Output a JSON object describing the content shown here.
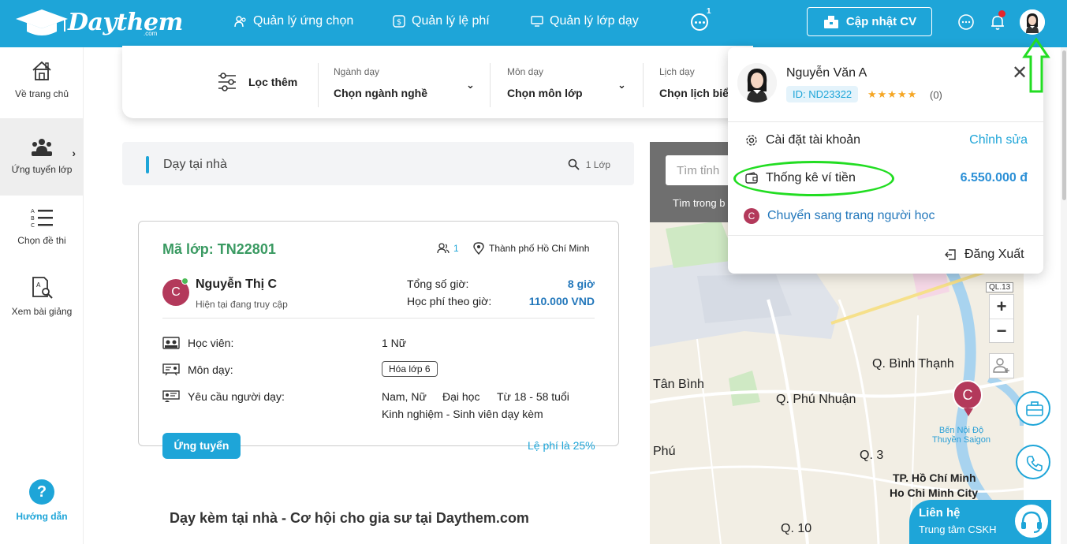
{
  "header": {
    "brand": "Daythem",
    "brand_suffix": ".com",
    "nav": [
      {
        "label": "Quản lý ứng chọn",
        "icon": "users-icon"
      },
      {
        "label": "Quản lý lệ phí",
        "icon": "dollar-icon"
      },
      {
        "label": "Quản lý lớp dạy",
        "icon": "monitor-icon"
      }
    ],
    "more_badge": "1",
    "cv_button": "Cập nhật CV"
  },
  "sidebar": {
    "items": [
      {
        "label": "Về trang chủ",
        "icon": "home-icon"
      },
      {
        "label": "Ứng tuyển lớp",
        "icon": "group-icon",
        "active": true
      },
      {
        "label": "Chọn đề thi",
        "icon": "abc-list-icon"
      },
      {
        "label": "Xem bài giảng",
        "icon": "document-search-icon"
      }
    ],
    "help_label": "Hướng dẫn",
    "help_symbol": "?"
  },
  "filter": {
    "main_label": "Lọc thêm",
    "groups": [
      {
        "label": "Ngành dạy",
        "value": "Chọn ngành nghề"
      },
      {
        "label": "Môn dạy",
        "value": "Chọn môn lớp"
      },
      {
        "label": "Lịch dạy",
        "value": "Chọn lịch biểu"
      }
    ]
  },
  "section": {
    "title": "Dạy tại nhà",
    "count": "1 Lớp"
  },
  "card": {
    "code": "Mã lớp: TN22801",
    "people": "1",
    "location": "Thành phố Hồ Chí Minh",
    "avatar_letter": "C",
    "name": "Nguyễn Thị C",
    "status": "Hiện tại đang truy cập",
    "hours_label": "Tổng số giờ:",
    "hours_value": "8 giờ",
    "fee_label": "Học phí theo giờ:",
    "fee_value": "110.000 VND",
    "students_label": "Học viên:",
    "students_value": "1 Nữ",
    "subject_label": "Môn dạy:",
    "subject_value": "Hóa lớp 6",
    "req_label": "Yêu cầu người dạy:",
    "req_gender": "Nam, Nữ",
    "req_level": "Đại học",
    "req_age": "Từ 18 - 58 tuổi",
    "req_exp": "Kinh nghiệm - Sinh viên dạy kèm",
    "apply_button": "Ứng tuyển",
    "fee_note": "Lệ phí là 25%"
  },
  "footer_text": "Dạy kèm tại nhà - Cơ hội cho gia sư tại Daythem.com",
  "map": {
    "search_placeholder": "Tìm tỉnh",
    "hint": "Tìm trong b",
    "labels": {
      "binh_thanh": "Q. Bình Thạnh",
      "tan_binh": "Tân Bình",
      "phu_nhuan": "Q. Phú Nhuận",
      "phu": "Phú",
      "q3": "Q. 3",
      "q10": "Q. 10",
      "city_vi": "TP. Hồ Chí Minh",
      "city_en": "Ho Chi Minh City",
      "ql": "QL.13",
      "ferry_1": "Bến Nội Độ",
      "ferry_2": "Thuyền Saigon"
    },
    "pin_letter": "C",
    "zoom_in": "+",
    "zoom_out": "−"
  },
  "contact": {
    "title": "Liên hệ",
    "subtitle": "Trung tâm CSKH"
  },
  "dropdown": {
    "name": "Nguyễn Văn A",
    "id": "ID: ND23322",
    "stars": "★★★★★",
    "rating": "(0)",
    "close": "✕",
    "settings_label": "Cài đặt tài khoản",
    "settings_action": "Chỉnh sửa",
    "wallet_label": "Thống kê ví tiền",
    "wallet_value": "6.550.000 đ",
    "switch_letter": "C",
    "switch_label": "Chuyển sang trang người học",
    "logout_label": "Đăng Xuất"
  },
  "colors": {
    "primary": "#1ea5d8",
    "green_code": "#3a9a62",
    "avatar": "#b3395b",
    "annotation": "#22dd22"
  }
}
